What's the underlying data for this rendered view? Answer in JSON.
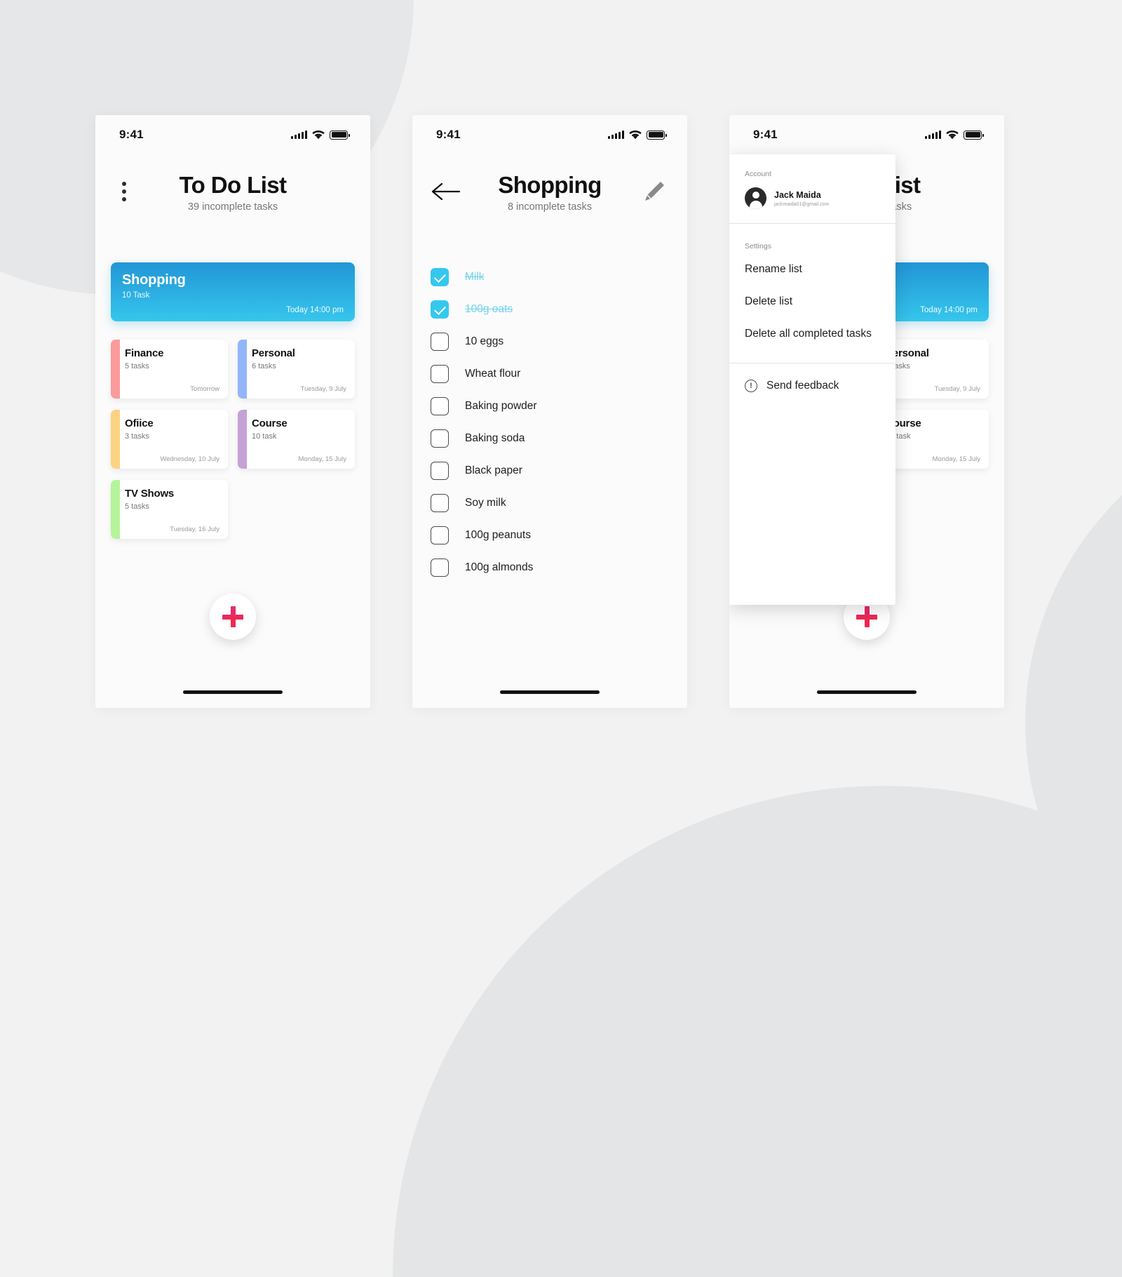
{
  "status_bar": {
    "time": "9:41",
    "signal_icon": "cellular-signal-icon",
    "wifi_icon": "wifi-icon",
    "battery_icon": "battery-full-icon"
  },
  "screen_home": {
    "menu_icon": "kebab-menu-icon",
    "title": "To Do List",
    "subtitle": "39 incomplete tasks",
    "featured": {
      "title": "Shopping",
      "count": "10 Task",
      "date": "Today 14:00 pm",
      "gradient_from": "#2196d6",
      "gradient_to": "#36c6ec"
    },
    "categories": [
      {
        "title": "Finance",
        "count": "5 tasks",
        "date": "Tomorrow",
        "color": "#fb9a9a"
      },
      {
        "title": "Personal",
        "count": "6 tasks",
        "date": "Tuesday, 9 July",
        "color": "#93b5fa"
      },
      {
        "title": "Ofiice",
        "count": "3 tasks",
        "date": "Wednesday, 10 July",
        "color": "#fcd283"
      },
      {
        "title": "Course",
        "count": "10 task",
        "date": "Monday, 15 July",
        "color": "#c5a2d6"
      },
      {
        "title": "TV Shows",
        "count": "5 tasks",
        "date": "Tuesday, 16 July",
        "color": "#b4f59a"
      }
    ],
    "fab": {
      "icon": "plus-icon",
      "color_from": "#e52a6d",
      "color_to": "#f32847"
    }
  },
  "screen_detail": {
    "back_icon": "back-arrow-icon",
    "title": "Shopping",
    "subtitle": "8 incomplete tasks",
    "edit_icon": "pencil-edit-icon",
    "checked_color": "#35c8ef",
    "tasks": [
      {
        "label": "Milk",
        "done": true
      },
      {
        "label": "100g oats",
        "done": true
      },
      {
        "label": "10 eggs",
        "done": false
      },
      {
        "label": "Wheat flour",
        "done": false
      },
      {
        "label": "Baking powder",
        "done": false
      },
      {
        "label": "Baking soda",
        "done": false
      },
      {
        "label": "Black paper",
        "done": false
      },
      {
        "label": "Soy milk",
        "done": false
      },
      {
        "label": "100g peanuts",
        "done": false
      },
      {
        "label": "100g almonds",
        "done": false
      }
    ]
  },
  "screen_menu": {
    "account_label": "Account",
    "account_name": "Jack Maida",
    "account_email": "jackmaida01@gmail.com",
    "avatar_icon": "user-avatar-icon",
    "settings_label": "Settings",
    "settings_items": [
      "Rename list",
      "Delete list",
      "Delete all completed tasks"
    ],
    "feedback_icon": "info-circle-icon",
    "feedback_label": "Send feedback"
  }
}
